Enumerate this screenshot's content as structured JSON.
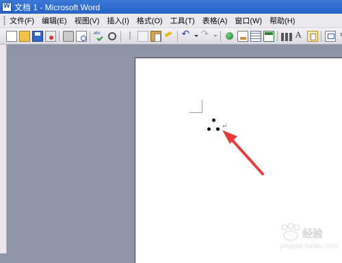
{
  "window": {
    "title": "文档 1 - Microsoft Word"
  },
  "menubar": {
    "items": [
      {
        "label": "文件(F)"
      },
      {
        "label": "编辑(E)"
      },
      {
        "label": "视图(V)"
      },
      {
        "label": "插入(I)"
      },
      {
        "label": "格式(O)"
      },
      {
        "label": "工具(T)"
      },
      {
        "label": "表格(A)"
      },
      {
        "label": "窗口(W)"
      },
      {
        "label": "帮助(H)"
      }
    ]
  },
  "toolbar": {
    "icons": [
      "new-icon",
      "open-icon",
      "save-icon",
      "permission-icon",
      "print-icon",
      "print-preview-icon",
      "spelling-icon",
      "research-icon",
      "cut-icon",
      "copy-icon",
      "paste-icon",
      "format-painter-icon",
      "undo-icon",
      "redo-icon",
      "hyperlink-icon",
      "tables-borders-icon",
      "insert-table-icon",
      "insert-excel-icon",
      "columns-icon",
      "drawing-icon",
      "document-map-icon",
      "show-hide-icon"
    ]
  },
  "document": {
    "paragraph_mark": "↵",
    "content_symbol": "therefore-dots"
  },
  "annotation": {
    "arrow_color": "#e83b3b"
  },
  "watermark": {
    "brand": "Baidu 经验",
    "url": "jingyan.baidu.com"
  },
  "colors": {
    "titlebar": "#2e6ad1",
    "workspace": "#8e95a8",
    "page": "#ffffff"
  }
}
